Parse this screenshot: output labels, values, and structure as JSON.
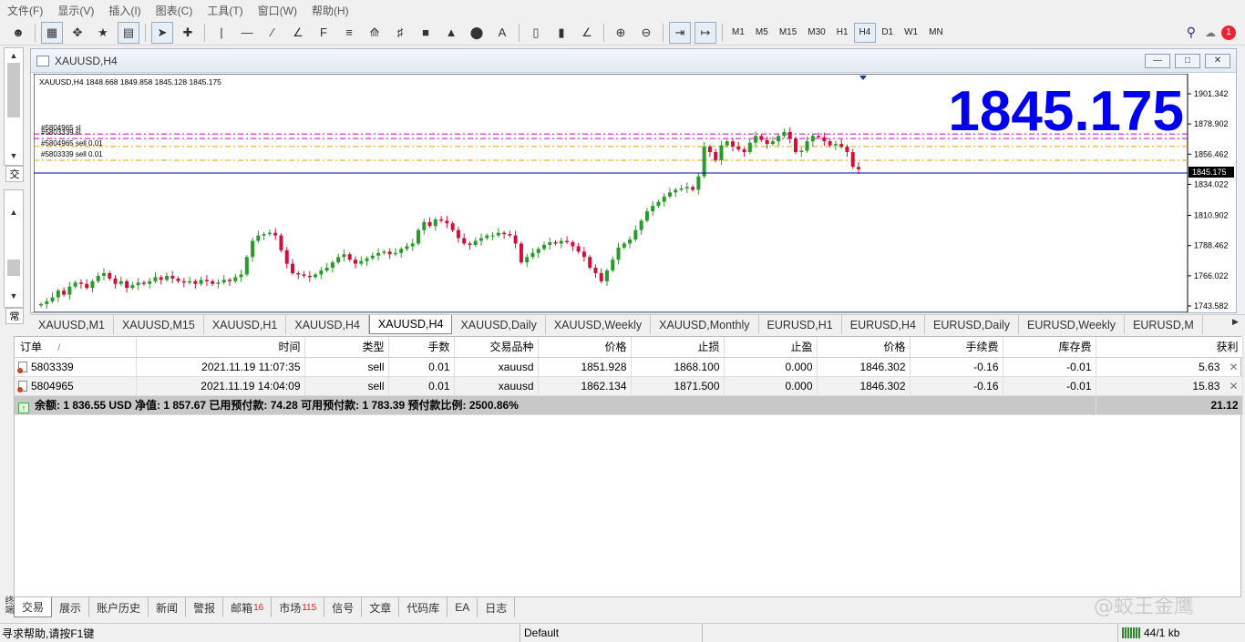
{
  "menu": [
    "文件(F)",
    "显示(V)",
    "插入(I)",
    "图表(C)",
    "工具(T)",
    "窗口(W)",
    "帮助(H)"
  ],
  "timeframes": [
    "M1",
    "M5",
    "M15",
    "M30",
    "H1",
    "H4",
    "D1",
    "W1",
    "MN"
  ],
  "active_timeframe": "H4",
  "notifications": "1",
  "left_tabs": [
    "交",
    "常"
  ],
  "chart_window": {
    "title": "XAUUSD,H4",
    "header": "XAUUSD,H4  1848.668 1849.858 1845.128 1845.175",
    "big_price": "1845.175",
    "price_axis": [
      "1901.342",
      "1878.902",
      "1856.462",
      "1834.022",
      "1810.902",
      "1788.462",
      "1766.022",
      "1743.582"
    ],
    "current_price_label": "1845.175",
    "order_labels": [
      "#5804965 sl",
      "#5803339 sl",
      "#5804965 sell 0.01",
      "#5803339 sell 0.01"
    ]
  },
  "chart_data": {
    "type": "candlestick",
    "symbol": "XAUUSD",
    "timeframe": "H4",
    "ylim": [
      1743.582,
      1901.342
    ],
    "current_price": 1845.175,
    "levels": [
      {
        "label": "#5804965 sl",
        "price": 1871.5,
        "color": "#cc00cc",
        "style": "dashdot"
      },
      {
        "label": "#5803339 sl",
        "price": 1868.1,
        "color": "#cc00cc",
        "style": "dashdot"
      },
      {
        "label": "#5804965 sell 0.01",
        "price": 1862.134,
        "color": "#e0a000",
        "style": "dashdot"
      },
      {
        "label": "#5803339 sell 0.01",
        "price": 1851.928,
        "color": "#e0a000",
        "style": "dashdot"
      }
    ],
    "closes": [
      1745,
      1747,
      1750,
      1755,
      1752,
      1758,
      1761,
      1760,
      1757,
      1762,
      1766,
      1768,
      1764,
      1760,
      1762,
      1757,
      1759,
      1761,
      1760,
      1762,
      1765,
      1763,
      1766,
      1764,
      1762,
      1761,
      1762,
      1760,
      1763,
      1762,
      1760,
      1761,
      1763,
      1762,
      1765,
      1767,
      1780,
      1792,
      1796,
      1797,
      1798,
      1796,
      1785,
      1775,
      1768,
      1767,
      1766,
      1765,
      1767,
      1770,
      1772,
      1776,
      1780,
      1782,
      1778,
      1775,
      1777,
      1779,
      1781,
      1783,
      1784,
      1782,
      1783,
      1786,
      1788,
      1790,
      1800,
      1806,
      1803,
      1808,
      1807,
      1805,
      1800,
      1794,
      1790,
      1789,
      1792,
      1794,
      1796,
      1796,
      1798,
      1797,
      1796,
      1790,
      1776,
      1780,
      1783,
      1786,
      1789,
      1791,
      1790,
      1792,
      1791,
      1788,
      1784,
      1780,
      1772,
      1768,
      1762,
      1770,
      1778,
      1787,
      1790,
      1793,
      1800,
      1807,
      1814,
      1818,
      1821,
      1825,
      1828,
      1830,
      1831,
      1832,
      1830,
      1840,
      1862,
      1858,
      1852,
      1863,
      1866,
      1862,
      1860,
      1858,
      1865,
      1870,
      1867,
      1864,
      1866,
      1870,
      1873,
      1868,
      1858,
      1859,
      1866,
      1870,
      1869,
      1866,
      1863,
      1864,
      1862,
      1858,
      1847,
      1845.175
    ]
  },
  "chart_tabs": [
    "XAUUSD,M1",
    "XAUUSD,M15",
    "XAUUSD,H1",
    "XAUUSD,H4",
    "XAUUSD,H4",
    "XAUUSD,Daily",
    "XAUUSD,Weekly",
    "XAUUSD,Monthly",
    "EURUSD,H1",
    "EURUSD,H4",
    "EURUSD,Daily",
    "EURUSD,Weekly",
    "EURUSD,M"
  ],
  "active_chart_tab": 4,
  "terminal": {
    "columns": [
      "订单",
      "时间",
      "类型",
      "手数",
      "交易品种",
      "价格",
      "止损",
      "止盈",
      "价格",
      "手续费",
      "库存费",
      "获利"
    ],
    "sort_mark": "/",
    "rows": [
      [
        "5803339",
        "2021.11.19 11:07:35",
        "sell",
        "0.01",
        "xauusd",
        "1851.928",
        "1868.100",
        "0.000",
        "1846.302",
        "-0.16",
        "-0.01",
        "5.63"
      ],
      [
        "5804965",
        "2021.11.19 14:04:09",
        "sell",
        "0.01",
        "xauusd",
        "1862.134",
        "1871.500",
        "0.000",
        "1846.302",
        "-0.16",
        "-0.01",
        "15.83"
      ]
    ],
    "summary": "余额: 1 836.55 USD  净值: 1 857.67  已用预付款: 74.28  可用预付款: 1 783.39  预付款比例: 2500.86%",
    "total_profit": "21.12",
    "side_label": "终端"
  },
  "terminal_tabs": [
    {
      "label": "交易",
      "count": ""
    },
    {
      "label": "展示",
      "count": ""
    },
    {
      "label": "账户历史",
      "count": ""
    },
    {
      "label": "新闻",
      "count": ""
    },
    {
      "label": "警报",
      "count": ""
    },
    {
      "label": "邮箱",
      "count": "16"
    },
    {
      "label": "市场",
      "count": "115"
    },
    {
      "label": "信号",
      "count": ""
    },
    {
      "label": "文章",
      "count": ""
    },
    {
      "label": "代码库",
      "count": ""
    },
    {
      "label": "EA",
      "count": ""
    },
    {
      "label": "日志",
      "count": ""
    }
  ],
  "watermark": "@蛟王金鹰",
  "status": {
    "help": "寻求帮助,请按F1键",
    "profile": "Default",
    "traffic": "44/1 kb"
  }
}
